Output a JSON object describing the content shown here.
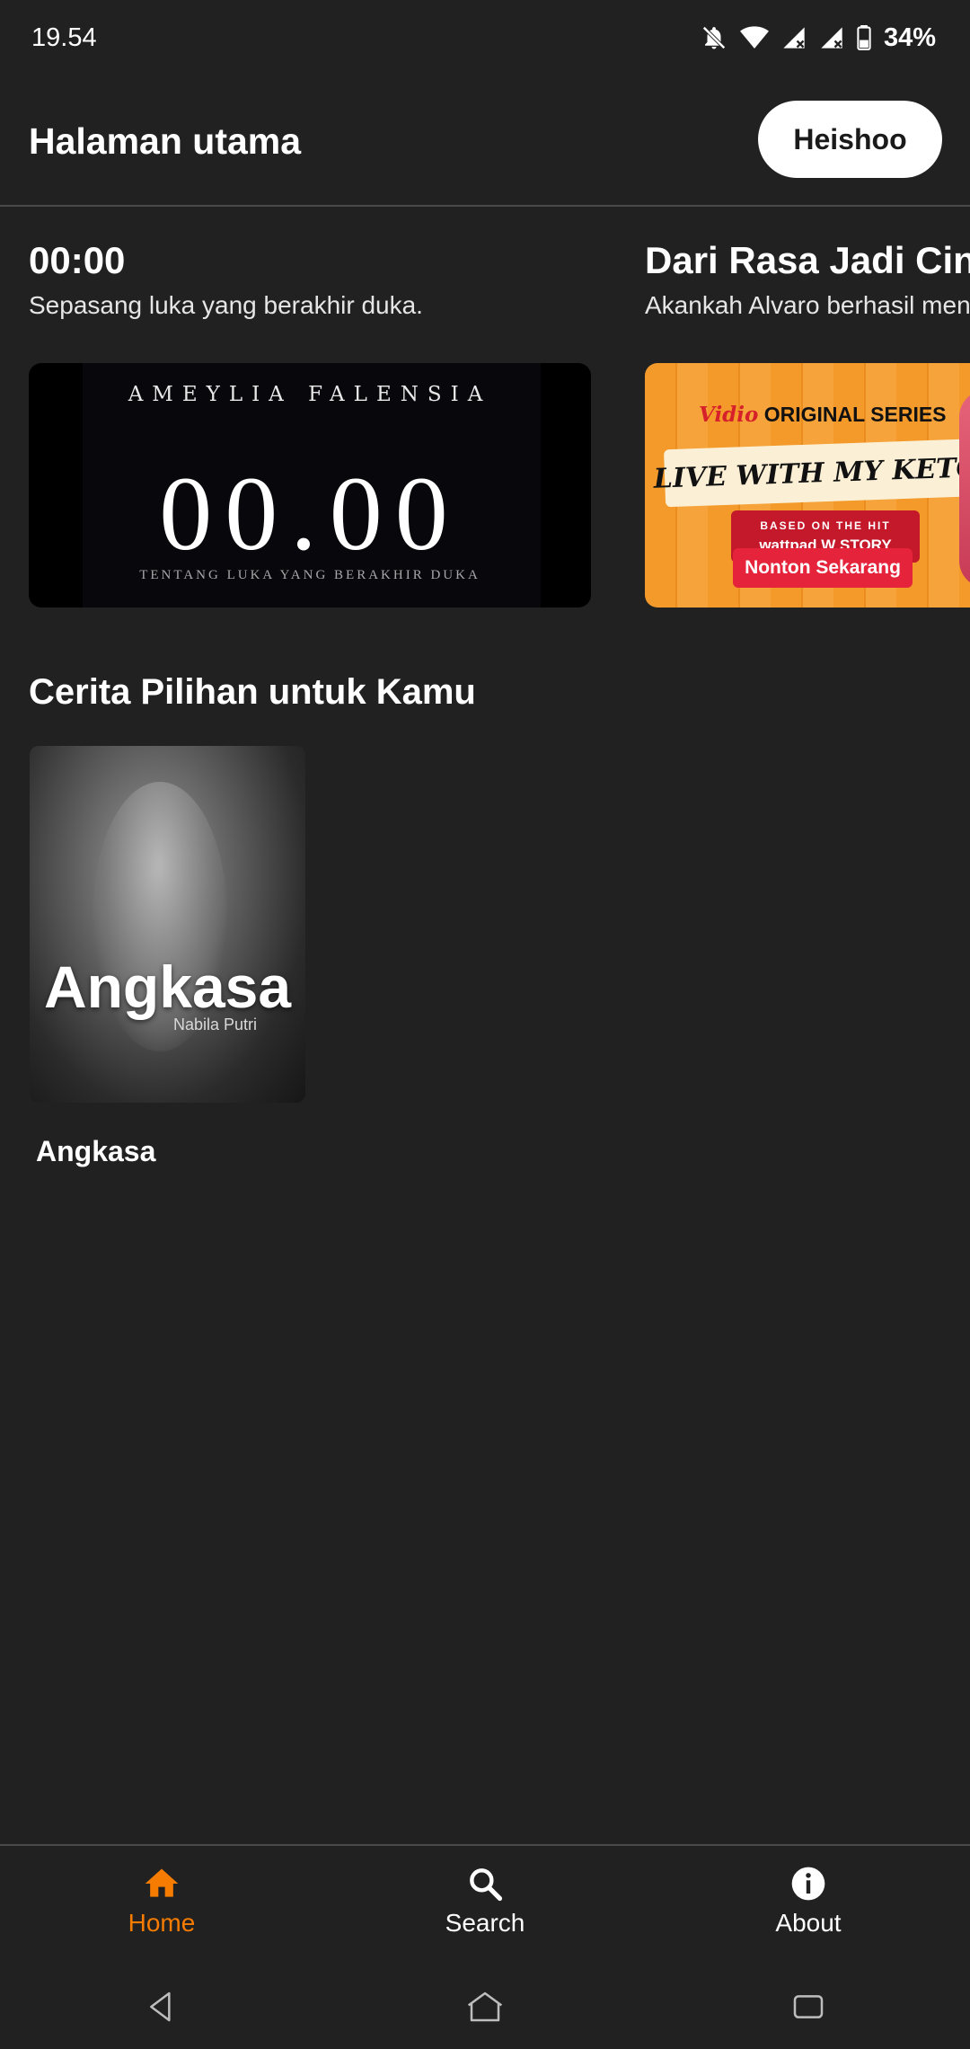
{
  "status_bar": {
    "time": "19.54",
    "battery": "34%",
    "icons": [
      "bell-off-icon",
      "wifi-icon",
      "signal-icon",
      "signal-icon",
      "battery-icon"
    ]
  },
  "header": {
    "title": "Halaman utama",
    "profile_button": "Heishoo"
  },
  "featured": [
    {
      "title": "00:00",
      "subtitle": "Sepasang luka yang berakhir duka.",
      "banner": {
        "author": "AMEYLIA FALENSIA",
        "big_text": "00.00",
        "tagline": "TENTANG LUKA YANG BERAKHIR DUKA"
      }
    },
    {
      "title": "Dari Rasa Jadi Cinta",
      "subtitle": "Akankah Alvaro berhasil mendapatkan hati",
      "banner": {
        "brand": "Vidio",
        "brand_suffix": "ORIGINAL SERIES",
        "title": "LIVE WITH MY KETOS",
        "based_on": "BASED ON THE HIT",
        "wattpad": "wattpad W STORY",
        "cta": "Nonton Sekarang"
      }
    }
  ],
  "section": {
    "title": "Cerita Pilihan untuk Kamu",
    "books": [
      {
        "title": "Angkasa",
        "cover_title": "Angkasa",
        "cover_author": "Nabila Putri"
      }
    ]
  },
  "bottom_nav": {
    "items": [
      {
        "label": "Home",
        "icon": "home-icon",
        "active": true
      },
      {
        "label": "Search",
        "icon": "search-icon",
        "active": false
      },
      {
        "label": "About",
        "icon": "info-icon",
        "active": false
      }
    ],
    "active_color": "#f57c00"
  },
  "system_nav": {
    "icons": [
      "back-icon",
      "home-outline-icon",
      "recents-icon"
    ]
  }
}
